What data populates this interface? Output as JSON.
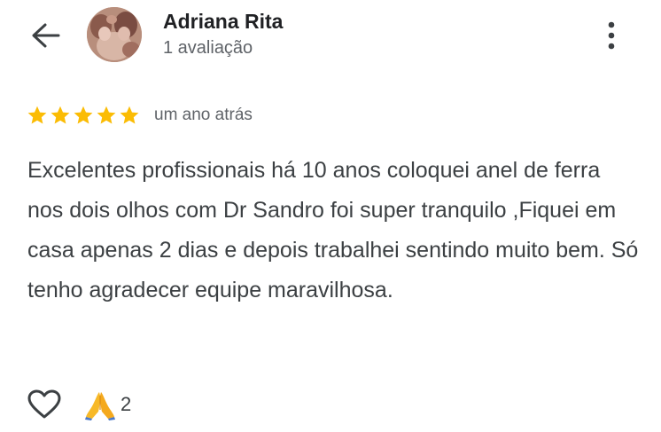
{
  "header": {
    "back_icon": "arrow-back-icon",
    "reviewer_name": "Adriana Rita",
    "reviewer_meta": "1 avaliação",
    "avatar_icon": "avatar-photo",
    "more_icon": "more-vert-icon"
  },
  "review": {
    "rating": 5,
    "rating_max": 5,
    "star_color": "#fbbc04",
    "time": "um ano atrás",
    "text": "Excelentes profissionais há 10 anos coloquei anel de ferra nos dois olhos com Dr Sandro foi super tranquilo ,Fiquei em casa apenas 2 dias e depois trabalhei sentindo muito bem. Só tenho agradecer equipe maravilhosa."
  },
  "reactions": {
    "like_icon": "heart-outline-icon",
    "emoji_icon": "folded-hands-emoji",
    "count": "2"
  }
}
